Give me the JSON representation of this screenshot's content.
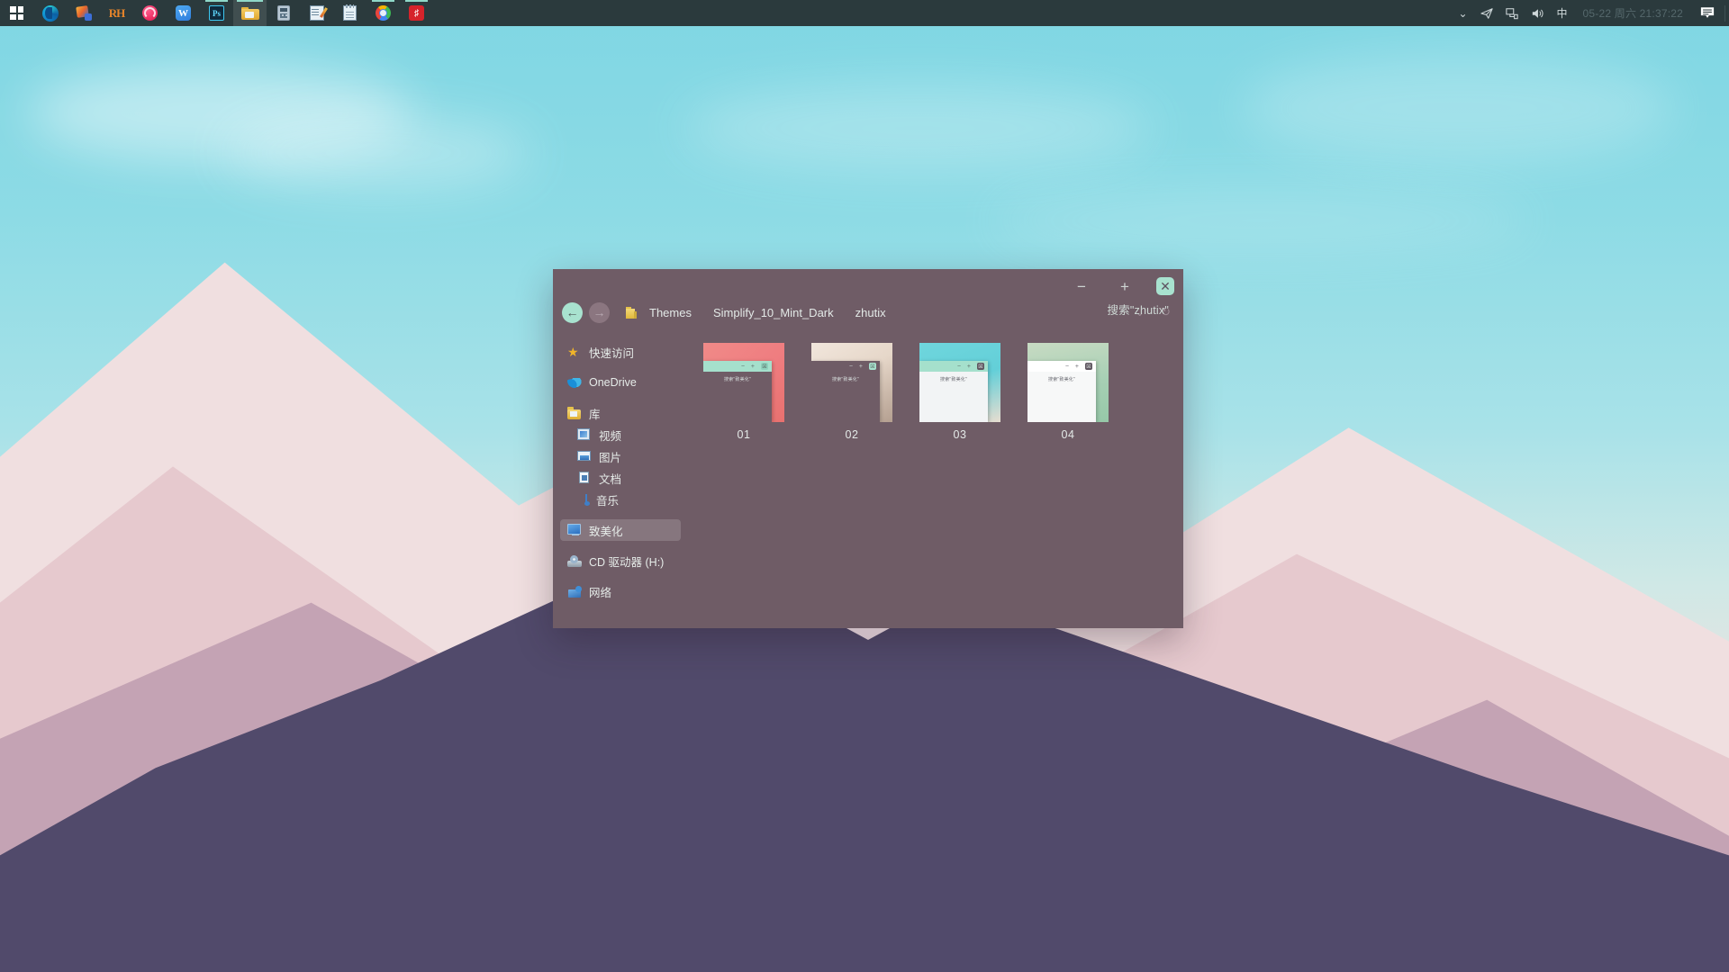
{
  "taskbar": {
    "start": {
      "name": "start-button",
      "label": "开始"
    },
    "apps": [
      {
        "name": "edge",
        "label": "Microsoft Edge",
        "icon": "edge-icon",
        "state": "normal"
      },
      {
        "name": "paint",
        "label": "画图",
        "icon": "paint-icon",
        "state": "normal"
      },
      {
        "name": "resource-hacker",
        "label": "RH",
        "icon": "rh-icon",
        "state": "normal"
      },
      {
        "name": "pink-app",
        "label": "录屏",
        "icon": "pink-circle-icon",
        "state": "normal"
      },
      {
        "name": "wps",
        "label": "W",
        "icon": "w-icon",
        "state": "normal"
      },
      {
        "name": "photoshop",
        "label": "Ps",
        "icon": "ps-icon",
        "state": "open"
      },
      {
        "name": "file-explorer",
        "label": "文件资源管理器",
        "icon": "folder-icon",
        "state": "active"
      },
      {
        "name": "calculator",
        "label": "计算器",
        "icon": "calculator-icon",
        "state": "normal"
      },
      {
        "name": "notepad-edit",
        "label": "写字板",
        "icon": "notepad-pen-icon",
        "state": "normal"
      },
      {
        "name": "notepad",
        "label": "记事本",
        "icon": "notepad-icon",
        "state": "normal"
      },
      {
        "name": "chrome",
        "label": "Google Chrome",
        "icon": "chrome-icon",
        "state": "open"
      },
      {
        "name": "netease-music",
        "label": "网易云音乐",
        "icon": "netease-icon",
        "state": "open"
      }
    ],
    "tray": {
      "chevron": "⌄",
      "telegram": "➤",
      "network": "network-icon",
      "volume": "🔊",
      "ime": "中",
      "clock": "05-22 周六 21:37:22",
      "notifications": "notification-icon"
    }
  },
  "explorer": {
    "controls": {
      "minimize": "−",
      "maximize": "+",
      "close": "✕"
    },
    "nav": {
      "back": "←",
      "forward": "→",
      "chevron": "⌄",
      "refresh": "↻"
    },
    "breadcrumbs": [
      "Themes",
      "Simplify_10_Mint_Dark",
      "zhutix"
    ],
    "search_placeholder": "搜索\"zhutix\"",
    "sidebar": [
      {
        "label": "快速访问",
        "icon": "star-icon",
        "indent": false,
        "selected": false,
        "gap_after": true
      },
      {
        "label": "OneDrive",
        "icon": "onedrive-icon",
        "indent": false,
        "selected": false,
        "gap_after": true
      },
      {
        "label": "库",
        "icon": "library-folder-icon",
        "indent": false,
        "selected": false,
        "gap_after": false
      },
      {
        "label": "视频",
        "icon": "video-icon",
        "indent": true,
        "selected": false,
        "gap_after": false
      },
      {
        "label": "图片",
        "icon": "picture-icon",
        "indent": true,
        "selected": false,
        "gap_after": false
      },
      {
        "label": "文档",
        "icon": "document-icon",
        "indent": true,
        "selected": false,
        "gap_after": false
      },
      {
        "label": "音乐",
        "icon": "music-icon",
        "indent": true,
        "selected": false,
        "gap_after": false
      },
      {
        "label": "致美化",
        "icon": "screen-icon",
        "indent": false,
        "selected": true,
        "gap_after": true
      },
      {
        "label": "CD 驱动器 (H:)",
        "icon": "cd-drive-icon",
        "indent": false,
        "selected": false,
        "gap_after": true
      },
      {
        "label": "网络",
        "icon": "network-folder-icon",
        "indent": false,
        "selected": false,
        "gap_after": false
      }
    ],
    "tiles": [
      {
        "label": "01",
        "bg": "linear-gradient(135deg,#f08a88 0%,#ef7d80 55%,#e8716f 100%)",
        "mini_title_bg": "#a5e0cc",
        "mini_title_fg": "#5f6f6a",
        "mini_close_bg": "#8fd2bd",
        "mini_close_fg": "#55605c",
        "mini_body_bg": "#6f5c66",
        "mini_body_fg": "#d7dedd",
        "search_text": "搜索\"致美化\""
      },
      {
        "label": "02",
        "bg": "linear-gradient(150deg,#f1e6dc 0%,#e6d7c9 45%,#b49f90 100%)",
        "mini_title_bg": "#6f5c66",
        "mini_title_fg": "#cdd6d4",
        "mini_close_bg": "#a8e2cf",
        "mini_close_fg": "#55605c",
        "mini_body_bg": "#6f5c66",
        "mini_body_fg": "#d7dedd",
        "search_text": "搜索\"致美化\""
      },
      {
        "label": "03",
        "bg": "linear-gradient(160deg,#6fd6dd 0%,#63cfd8 50%,#e8ddd0 100%)",
        "mini_title_bg": "#a5e0cc",
        "mini_title_fg": "#5f6f6a",
        "mini_close_bg": "#5f5660",
        "mini_close_fg": "#dfe6e4",
        "mini_body_bg": "#f2f4f5",
        "mini_body_fg": "#6a6a72",
        "search_text": "搜索\"致美化\""
      },
      {
        "label": "04",
        "bg": "linear-gradient(170deg,#c8dbc3 0%,#a6cfb4 55%,#96c8a8 100%)",
        "mini_title_bg": "#ffffff",
        "mini_title_fg": "#6a6a72",
        "mini_close_bg": "#5f5660",
        "mini_close_fg": "#dfe6e4",
        "mini_body_bg": "#f7f8f8",
        "mini_body_fg": "#6a6a72",
        "search_text": "搜索\"致美化\""
      }
    ]
  },
  "colors": {
    "window_bg": "#6f5c66",
    "accent_mint": "#a8e2cf",
    "taskbar_bg": "#2b3a3d",
    "text": "#dfe6e4"
  }
}
